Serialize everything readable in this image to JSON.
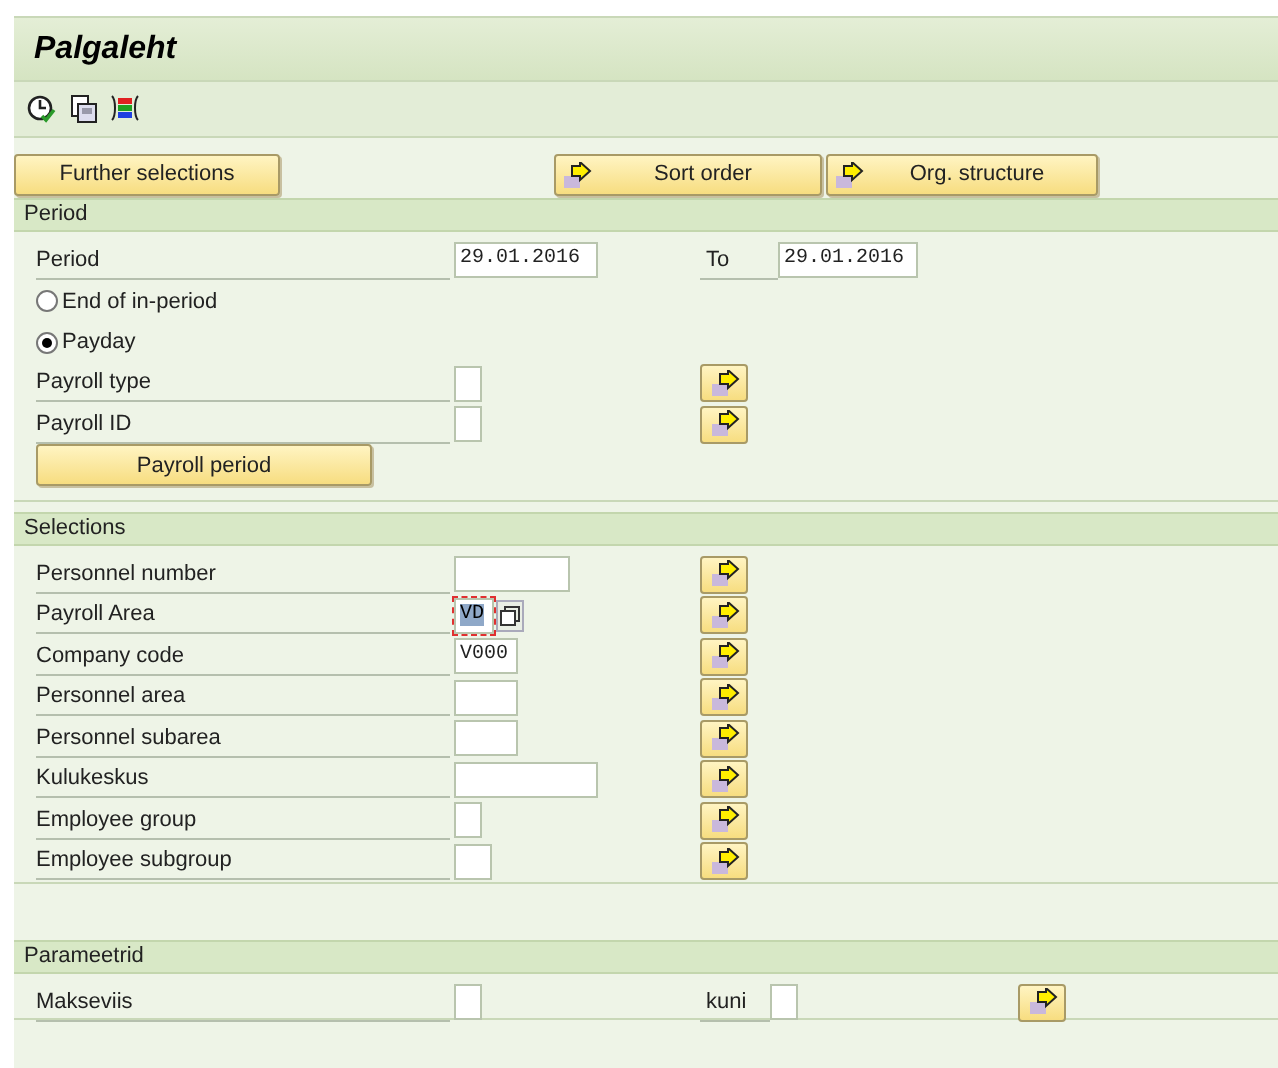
{
  "window": {
    "title": "Palgaleht"
  },
  "top_buttons": [
    {
      "label": "Further selections",
      "arrow": false
    },
    {
      "label": "Sort order",
      "arrow": true
    },
    {
      "label": "Org. structure",
      "arrow": true
    }
  ],
  "sections": [
    {
      "title": "Period",
      "rows": [
        {
          "kind": "field",
          "label": "Period",
          "value": "29.01.2016",
          "to_label": "To",
          "to_value": "29.01.2016",
          "multiple_selection": false
        },
        {
          "kind": "radio",
          "label": "End of in-period",
          "selected": false
        },
        {
          "kind": "radio",
          "label": "Payday",
          "selected": true
        },
        {
          "kind": "field",
          "label": "Payroll type",
          "multiple_selection": true
        },
        {
          "kind": "field",
          "label": "Payroll ID",
          "multiple_selection": true
        },
        {
          "kind": "button",
          "label": "Payroll period"
        }
      ]
    },
    {
      "title": "Selections",
      "rows": [
        {
          "kind": "field",
          "label": "Personnel number",
          "multiple_selection": true
        },
        {
          "kind": "field",
          "label": "Payroll Area",
          "value": "VD",
          "focused": true,
          "value_help": true,
          "multiple_selection": true
        },
        {
          "kind": "field",
          "label": "Company code",
          "value": "V000",
          "multiple_selection": true
        },
        {
          "kind": "field",
          "label": "Personnel area",
          "multiple_selection": true
        },
        {
          "kind": "field",
          "label": "Personnel subarea",
          "multiple_selection": true
        },
        {
          "kind": "field",
          "label": "Kulukeskus",
          "multiple_selection": true
        },
        {
          "kind": "field",
          "label": "Employee group",
          "multiple_selection": true
        },
        {
          "kind": "field",
          "label": "Employee subgroup",
          "multiple_selection": true
        }
      ]
    },
    {
      "title": "Parameetrid",
      "rows": [
        {
          "kind": "field",
          "label": "Makseviis",
          "to_label": "kuni",
          "multiple_selection": true
        }
      ]
    }
  ]
}
